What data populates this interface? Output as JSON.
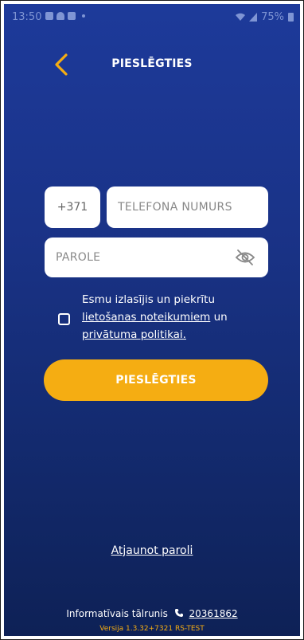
{
  "status_bar": {
    "time": "13:50",
    "battery": "75%"
  },
  "header": {
    "title": "PIESLĒGTIES",
    "back_icon": "chevron-left-icon"
  },
  "form": {
    "phone_prefix": "+371",
    "phone_placeholder": "TELEFONA NUMURS",
    "phone_value": "",
    "password_placeholder": "PAROLE",
    "password_value": "",
    "eye_icon": "eye-off-icon",
    "consent": {
      "checked": false,
      "text_before": "Esmu izlasījis un piekrītu",
      "terms_link": "lietošanas noteikumiem",
      "text_middle": "un",
      "privacy_link": "privātuma politikai."
    },
    "submit_label": "PIESLĒGTIES"
  },
  "reset_password_label": "Atjaunot paroli",
  "footer": {
    "info_label": "Informatīvais tālrunis",
    "phone_icon": "phone-icon",
    "phone_number": "20361862",
    "version": "Versija 1.3.32+7321 RS-TEST"
  },
  "colors": {
    "accent": "#f5ad12",
    "background_top": "#1d3a9a",
    "background_bottom": "#0e2156"
  }
}
